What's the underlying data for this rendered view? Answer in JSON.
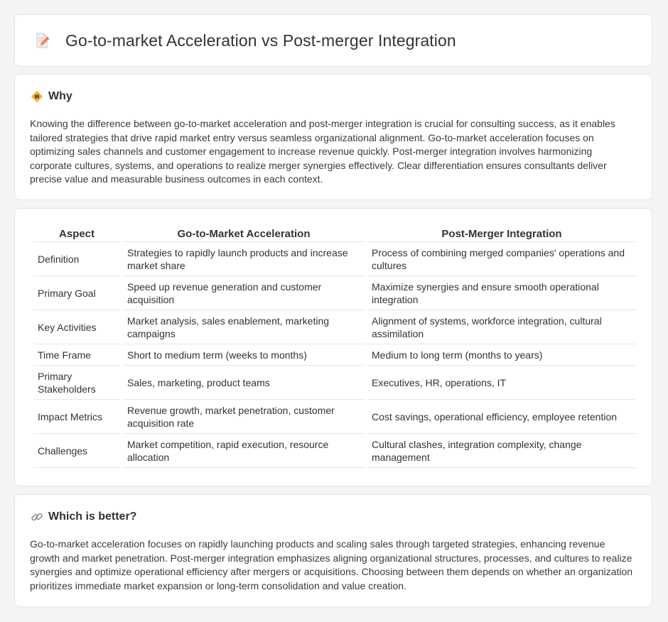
{
  "header": {
    "title": "Go-to-market Acceleration vs Post-merger Integration",
    "icon": "document-pencil-icon"
  },
  "why": {
    "title": "Why",
    "icon": "diamond-signal-icon",
    "body": "Knowing the difference between go-to-market acceleration and post-merger integration is crucial for consulting success, as it enables tailored strategies that drive rapid market entry versus seamless organizational alignment. Go-to-market acceleration focuses on optimizing sales channels and customer engagement to increase revenue quickly. Post-merger integration involves harmonizing corporate cultures, systems, and operations to realize merger synergies effectively. Clear differentiation ensures consultants deliver precise value and measurable business outcomes in each context."
  },
  "table": {
    "headers": [
      "Aspect",
      "Go-to-Market Acceleration",
      "Post-Merger Integration"
    ],
    "rows": [
      [
        "Definition",
        "Strategies to rapidly launch products and increase market share",
        "Process of combining merged companies' operations and cultures"
      ],
      [
        "Primary Goal",
        "Speed up revenue generation and customer acquisition",
        "Maximize synergies and ensure smooth operational integration"
      ],
      [
        "Key Activities",
        "Market analysis, sales enablement, marketing campaigns",
        "Alignment of systems, workforce integration, cultural assimilation"
      ],
      [
        "Time Frame",
        "Short to medium term (weeks to months)",
        "Medium to long term (months to years)"
      ],
      [
        "Primary Stakeholders",
        "Sales, marketing, product teams",
        "Executives, HR, operations, IT"
      ],
      [
        "Impact Metrics",
        "Revenue growth, market penetration, customer acquisition rate",
        "Cost savings, operational efficiency, employee retention"
      ],
      [
        "Challenges",
        "Market competition, rapid execution, resource allocation",
        "Cultural clashes, integration complexity, change management"
      ]
    ]
  },
  "better": {
    "title": "Which is better?",
    "icon": "link-icon",
    "body": "Go-to-market acceleration focuses on rapidly launching products and scaling sales through targeted strategies, enhancing revenue growth and market penetration. Post-merger integration emphasizes aligning organizational structures, processes, and cultures to realize synergies and optimize operational efficiency after mergers or acquisitions. Choosing between them depends on whether an organization prioritizes immediate market expansion or long-term consolidation and value creation."
  },
  "colors": {
    "background": "#f3f4f6",
    "card": "#ffffff",
    "border": "#e3e5e8",
    "text": "#333333",
    "icon_accent": "#f08a5d",
    "diamond": "#f5a623"
  }
}
